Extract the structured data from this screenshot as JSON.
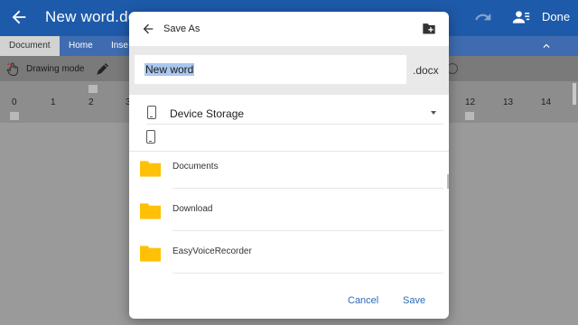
{
  "app": {
    "document_title": "New word.docx",
    "done_label": "Done",
    "tabs": [
      {
        "label": "Document"
      },
      {
        "label": "Home"
      },
      {
        "label": "Inse"
      }
    ],
    "toolbar": {
      "drawing_mode_label": "Drawing mode"
    },
    "ruler_ticks": [
      "0",
      "1",
      "2",
      "3",
      "12",
      "13",
      "14"
    ]
  },
  "dialog": {
    "title": "Save As",
    "file_name_value": "New word",
    "extension": ".docx",
    "storage": {
      "label": "Device Storage"
    },
    "folders": [
      {
        "label": "Documents",
        "icon": "folder-icon"
      },
      {
        "label": "Download",
        "icon": "folder-icon"
      },
      {
        "label": "EasyVoiceRecorder",
        "icon": "folder-icon"
      }
    ],
    "cancel_label": "Cancel",
    "save_label": "Save"
  },
  "colors": {
    "app_bar": "#1e5aaa",
    "accent": "#2b6bb8",
    "folder": "#ffc107",
    "selection": "#aac8ef"
  }
}
